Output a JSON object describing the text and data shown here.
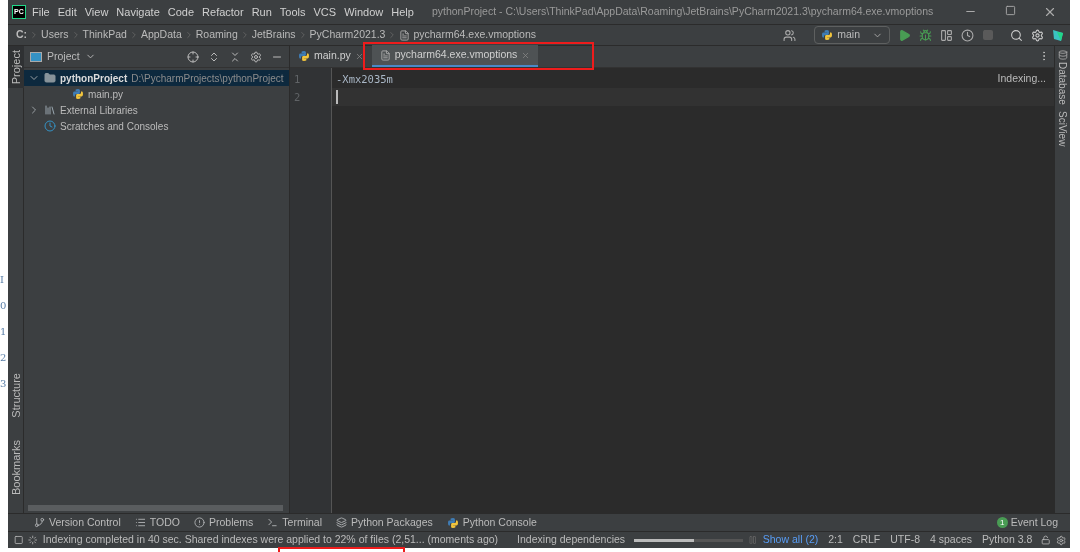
{
  "background_fragments": [
    "I",
    "0",
    "1",
    "2",
    "3"
  ],
  "menu_bar": {
    "logo": "PC",
    "items": [
      "File",
      "Edit",
      "View",
      "Navigate",
      "Code",
      "Refactor",
      "Run",
      "Tools",
      "VCS",
      "Window",
      "Help"
    ],
    "title": "pythonProject - C:\\Users\\ThinkPad\\AppData\\Roaming\\JetBrains\\PyCharm2021.3\\pycharm64.exe.vmoptions"
  },
  "breadcrumbs": [
    "C:",
    "Users",
    "ThinkPad",
    "AppData",
    "Roaming",
    "JetBrains",
    "PyCharm2021.3",
    "pycharm64.exe.vmoptions"
  ],
  "run_config": "main",
  "left_stripe": [
    {
      "label": "Project",
      "selected": true
    },
    {
      "label": "Structure",
      "selected": false
    },
    {
      "label": "Bookmarks",
      "selected": false
    }
  ],
  "right_stripe": [
    "Database",
    "SciView"
  ],
  "project_panel": {
    "title": "Project",
    "tree": [
      {
        "label": "pythonProject",
        "path": "D:\\PycharmProjects\\pythonProject",
        "kind": "folder",
        "expanded": true,
        "selected": true,
        "children": [
          {
            "label": "main.py",
            "kind": "python",
            "selected": false
          }
        ]
      },
      {
        "label": "External Libraries",
        "kind": "libraries",
        "expanded": false,
        "selected": false
      },
      {
        "label": "Scratches and Consoles",
        "kind": "scratches",
        "selected": false
      }
    ]
  },
  "editor": {
    "tabs": [
      {
        "label": "main.py",
        "kind": "python",
        "selected": false
      },
      {
        "label": "pycharm64.exe.vmoptions",
        "kind": "text",
        "selected": true
      }
    ],
    "lines": [
      {
        "number": "1",
        "text": "-Xmx2035m"
      },
      {
        "number": "2"
      }
    ],
    "status": "Indexing..."
  },
  "tool_windows": [
    {
      "label": "Version Control",
      "kind": "vcs"
    },
    {
      "label": "TODO",
      "kind": "todo"
    },
    {
      "label": "Problems",
      "kind": "problems"
    },
    {
      "label": "Terminal",
      "kind": "terminal"
    },
    {
      "label": "Python Packages",
      "kind": "packages"
    },
    {
      "label": "Python Console",
      "kind": "console"
    }
  ],
  "event_log": {
    "count": "1",
    "label": "Event Log"
  },
  "status_bar": {
    "message": "Indexing completed in 40 sec. Shared indexes were applied to 22% of files (2,51... (moments ago)",
    "task": "Indexing dependencies",
    "level": 0.55,
    "show_all": "Show all (2)",
    "items": [
      "2:1",
      "CRLF",
      "UTF-8",
      "4 spaces",
      "Python 3.8"
    ]
  }
}
